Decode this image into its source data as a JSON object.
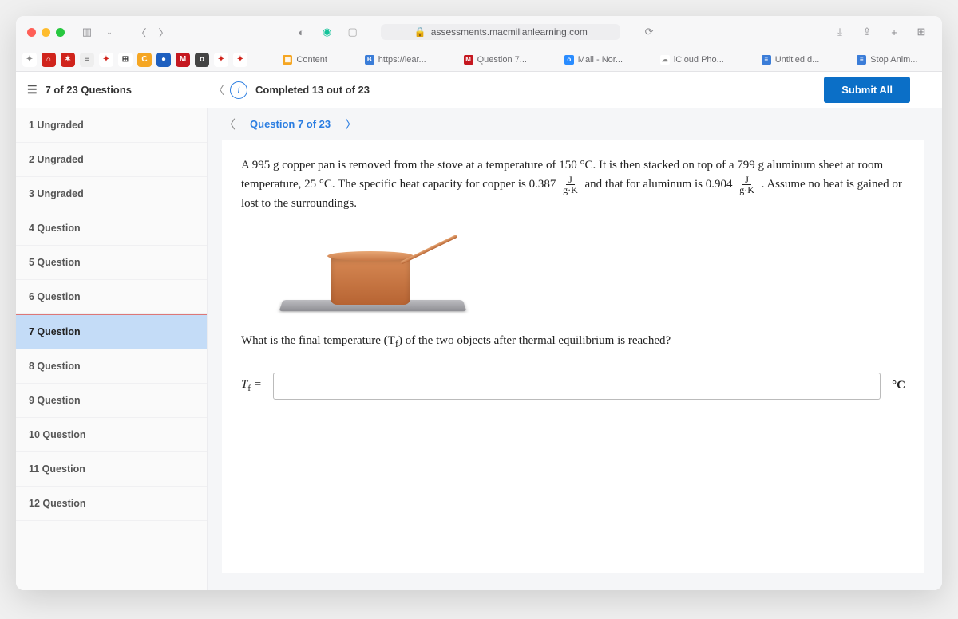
{
  "browser": {
    "url": "assessments.macmillanlearning.com",
    "favicons": [
      {
        "bg": "#fff",
        "fg": "#888",
        "txt": "✦"
      },
      {
        "bg": "#d0241c",
        "fg": "#fff",
        "txt": "⌂"
      },
      {
        "bg": "#d0241c",
        "fg": "#fff",
        "txt": "✶"
      },
      {
        "bg": "#eee",
        "fg": "#666",
        "txt": "≡"
      },
      {
        "bg": "#fff",
        "fg": "#d0241c",
        "txt": "✦"
      },
      {
        "bg": "#fff",
        "fg": "#333",
        "txt": "⊞"
      },
      {
        "bg": "#f5a623",
        "fg": "#fff",
        "txt": "C"
      },
      {
        "bg": "#1e5fbf",
        "fg": "#fff",
        "txt": "●"
      },
      {
        "bg": "#c5171f",
        "fg": "#fff",
        "txt": "M"
      },
      {
        "bg": "#444",
        "fg": "#fff",
        "txt": "o"
      },
      {
        "bg": "#fff",
        "fg": "#d0241c",
        "txt": "✦"
      },
      {
        "bg": "#fff",
        "fg": "#d0241c",
        "txt": "✦"
      }
    ],
    "tabs": [
      {
        "ico_bg": "#f5a623",
        "ico": "▦",
        "label": "Content"
      },
      {
        "ico_bg": "#3b7dd8",
        "ico": "B",
        "label": "https://lear..."
      },
      {
        "ico_bg": "#c5171f",
        "ico": "M",
        "label": "Question 7..."
      },
      {
        "ico_bg": "#2a8cff",
        "ico": "o",
        "label": "Mail - Nor..."
      },
      {
        "ico_bg": "#ffffff",
        "ico": "",
        "label": "iCloud Pho...",
        "fg": "#888"
      },
      {
        "ico_bg": "#3b7dd8",
        "ico": "≡",
        "label": "Untitled d..."
      },
      {
        "ico_bg": "#3b7dd8",
        "ico": "≡",
        "label": "Stop Anim..."
      }
    ]
  },
  "header": {
    "progress_label": "7 of 23 Questions",
    "completed": "Completed 13 out of 23",
    "submit": "Submit All"
  },
  "sidebar": {
    "items": [
      {
        "label": "1 Ungraded"
      },
      {
        "label": "2 Ungraded"
      },
      {
        "label": "3 Ungraded"
      },
      {
        "label": "4 Question"
      },
      {
        "label": "5 Question"
      },
      {
        "label": "6 Question"
      },
      {
        "label": "7 Question",
        "active": true
      },
      {
        "label": "8 Question"
      },
      {
        "label": "9 Question"
      },
      {
        "label": "10 Question"
      },
      {
        "label": "11 Question"
      },
      {
        "label": "12 Question"
      }
    ]
  },
  "crumb": {
    "label": "Question 7 of 23"
  },
  "question": {
    "text_a": "A 995 g copper pan is removed from the stove at a temperature of 150 °C. It is then stacked on top of a 799 g aluminum sheet at room temperature, 25 °C. The specific heat capacity for copper is 0.387 ",
    "frac1_n": "J",
    "frac1_d": "g·K",
    "text_b": " and that for aluminum is 0.904 ",
    "frac2_n": "J",
    "frac2_d": "g·K",
    "text_c": ". Assume no heat is gained or lost to the surroundings.",
    "prompt": "What is the final temperature (T",
    "prompt_sub": "f",
    "prompt_tail": ") of the two objects after thermal equilibrium is reached?"
  },
  "answer": {
    "var": "T",
    "sub": "f",
    "eq": " =",
    "value": "",
    "unit": "°C"
  }
}
